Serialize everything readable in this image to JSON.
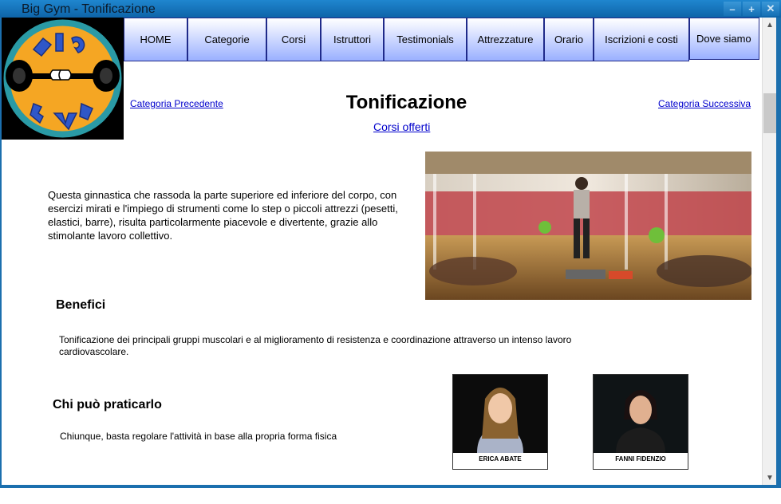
{
  "window": {
    "title": "Big Gym - Tonificazione",
    "buttons": [
      "minimize-icon",
      "maximize-icon",
      "close-icon"
    ]
  },
  "logo": {
    "top_text": "BIG",
    "bottom_text": "GYM"
  },
  "nav": [
    {
      "label": "HOME"
    },
    {
      "label": "Categorie"
    },
    {
      "label": "Corsi"
    },
    {
      "label": "Istruttori"
    },
    {
      "label": "Testimonials"
    },
    {
      "label": "Attrezzature"
    },
    {
      "label": "Orario"
    },
    {
      "label": "Iscrizioni e costi"
    },
    {
      "label": "Dove siamo"
    }
  ],
  "page": {
    "prev_label": "Categoria Precedente",
    "next_label": "Categoria Successiva",
    "title": "Tonificazione",
    "courses_label": "Corsi offerti",
    "intro": "Questa ginnastica che rassoda la parte superiore ed inferiore del corpo, con esercizi mirati e l'impiego di strumenti come lo step o piccoli attrezzi (pesetti, elastici, barre), risulta particolarmente piacevole e divertente, grazie allo stimolante lavoro collettivo.",
    "benefici_heading": "Benefici",
    "benefici_text": "Tonificazione dei principali gruppi muscolari e al miglioramento di resistenza e coordinazione attraverso un intenso lavoro cardiovascolare.",
    "chi_heading": "Chi può praticarlo",
    "chi_text": "Chiunque, basta regolare l'attività in base alla propria forma fisica"
  },
  "instructors": [
    {
      "name": "ERICA ABATE"
    },
    {
      "name": "FANNI FIDENZIO"
    }
  ],
  "colors": {
    "frame": "#1b6fae",
    "nav_border": "#1f2a8a",
    "nav_bottom": "#9ab0ff",
    "logo_orange": "#f5a623",
    "link": "#0000cc"
  }
}
